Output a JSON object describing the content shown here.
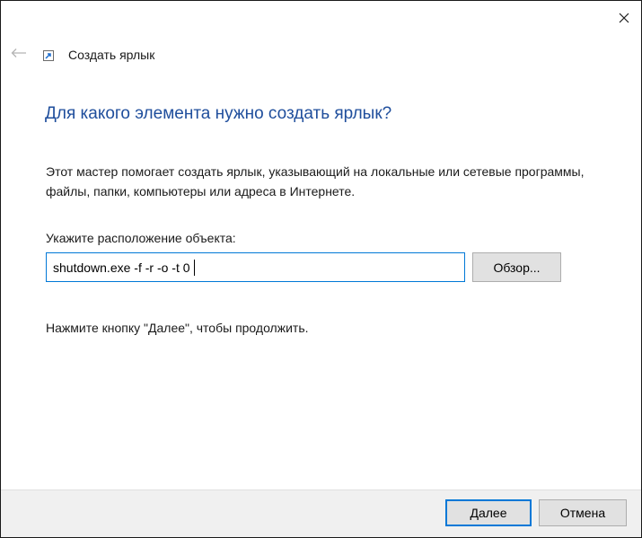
{
  "window": {
    "close_icon": "close-icon",
    "back_icon": "back-arrow-icon"
  },
  "wizard": {
    "title": "Создать ярлык",
    "title_icon": "shortcut-icon",
    "heading": "Для какого элемента нужно создать ярлык?",
    "description": "Этот мастер помогает создать ярлык, указывающий на локальные или сетевые программы, файлы, папки, компьютеры или адреса в Интернете.",
    "location_label": "Укажите расположение объекта:",
    "location_value": "shutdown.exe -f -r -o -t 0",
    "browse_label": "Обзор...",
    "hint": "Нажмите кнопку \"Далее\", чтобы продолжить."
  },
  "footer": {
    "next_label": "Далее",
    "cancel_label": "Отмена"
  },
  "colors": {
    "heading": "#1f4e9c",
    "accent": "#0078d7",
    "footer_bg": "#f0f0f0",
    "button_bg": "#e1e1e1"
  }
}
